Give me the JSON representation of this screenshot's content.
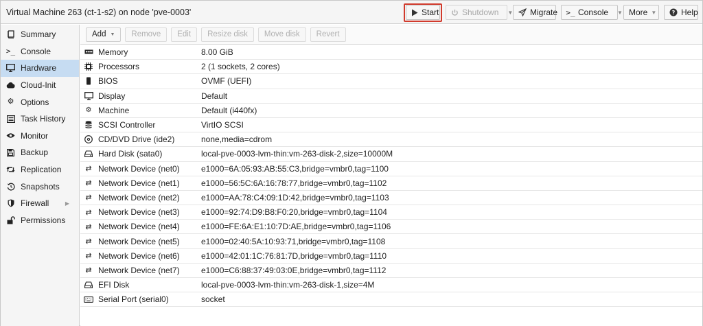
{
  "window": {
    "title": "Virtual Machine 263 (ct-1-s2) on node 'pve-0003'"
  },
  "header_buttons": {
    "start": "Start",
    "shutdown": "Shutdown",
    "migrate": "Migrate",
    "console": "Console",
    "more": "More",
    "help": "Help"
  },
  "sidebar": {
    "items": [
      {
        "label": "Summary",
        "icon": "book-icon"
      },
      {
        "label": "Console",
        "icon": "terminal-icon"
      },
      {
        "label": "Hardware",
        "icon": "monitor-icon",
        "active": true
      },
      {
        "label": "Cloud-Init",
        "icon": "cloud-icon"
      },
      {
        "label": "Options",
        "icon": "gear-icon"
      },
      {
        "label": "Task History",
        "icon": "list-icon"
      },
      {
        "label": "Monitor",
        "icon": "eye-icon"
      },
      {
        "label": "Backup",
        "icon": "floppy-icon"
      },
      {
        "label": "Replication",
        "icon": "retweet-icon"
      },
      {
        "label": "Snapshots",
        "icon": "history-icon"
      },
      {
        "label": "Firewall",
        "icon": "shield-icon"
      },
      {
        "label": "Permissions",
        "icon": "unlock-icon"
      }
    ]
  },
  "toolbar": {
    "add": "Add",
    "remove": "Remove",
    "edit": "Edit",
    "resize_disk": "Resize disk",
    "move_disk": "Move disk",
    "revert": "Revert"
  },
  "hardware": [
    {
      "icon": "memory-icon",
      "name": "Memory",
      "value": "8.00 GiB"
    },
    {
      "icon": "cpu-icon",
      "name": "Processors",
      "value": "2 (1 sockets, 2 cores)"
    },
    {
      "icon": "chip-icon",
      "name": "BIOS",
      "value": "OVMF (UEFI)"
    },
    {
      "icon": "desktop-icon",
      "name": "Display",
      "value": "Default"
    },
    {
      "icon": "cogs-icon",
      "name": "Machine",
      "value": "Default (i440fx)"
    },
    {
      "icon": "database-icon",
      "name": "SCSI Controller",
      "value": "VirtIO SCSI"
    },
    {
      "icon": "cdrom-icon",
      "name": "CD/DVD Drive (ide2)",
      "value": "none,media=cdrom"
    },
    {
      "icon": "harddisk-icon",
      "name": "Hard Disk (sata0)",
      "value": "local-pve-0003-lvm-thin:vm-263-disk-2,size=10000M"
    },
    {
      "icon": "network-icon",
      "name": "Network Device (net0)",
      "value": "e1000=6A:05:93:AB:55:C3,bridge=vmbr0,tag=1100"
    },
    {
      "icon": "network-icon",
      "name": "Network Device (net1)",
      "value": "e1000=56:5C:6A:16:78:77,bridge=vmbr0,tag=1102"
    },
    {
      "icon": "network-icon",
      "name": "Network Device (net2)",
      "value": "e1000=AA:78:C4:09:1D:42,bridge=vmbr0,tag=1103"
    },
    {
      "icon": "network-icon",
      "name": "Network Device (net3)",
      "value": "e1000=92:74:D9:B8:F0:20,bridge=vmbr0,tag=1104"
    },
    {
      "icon": "network-icon",
      "name": "Network Device (net4)",
      "value": "e1000=FE:6A:E1:10:7D:AE,bridge=vmbr0,tag=1106"
    },
    {
      "icon": "network-icon",
      "name": "Network Device (net5)",
      "value": "e1000=02:40:5A:10:93:71,bridge=vmbr0,tag=1108"
    },
    {
      "icon": "network-icon",
      "name": "Network Device (net6)",
      "value": "e1000=42:01:1C:76:81:7D,bridge=vmbr0,tag=1110"
    },
    {
      "icon": "network-icon",
      "name": "Network Device (net7)",
      "value": "e1000=C6:88:37:49:03:0E,bridge=vmbr0,tag=1112"
    },
    {
      "icon": "harddisk-icon",
      "name": "EFI Disk",
      "value": "local-pve-0003-lvm-thin:vm-263-disk-1,size=4M"
    },
    {
      "icon": "keyboard-icon",
      "name": "Serial Port (serial0)",
      "value": "socket"
    }
  ],
  "colors": {
    "active_nav": "#c6dcf2",
    "highlight_border": "#d13a2c"
  }
}
